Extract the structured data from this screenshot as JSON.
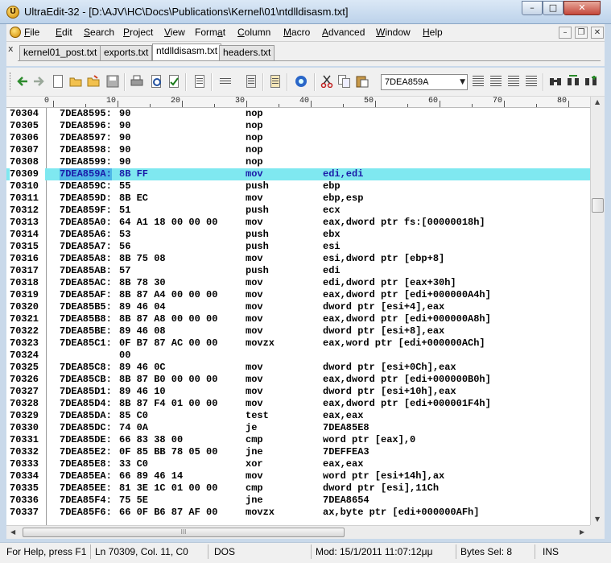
{
  "window": {
    "title": "UltraEdit-32 - [D:\\AJV\\HC\\Docs\\Publications\\Kernel\\01\\ntdlldisasm.txt]",
    "app_icon": "ultraedit-logo-icon",
    "controls": {
      "minimize": "–",
      "maximize": "□",
      "close": "✕"
    }
  },
  "menu": {
    "items": [
      {
        "key": "F",
        "rest": "ile"
      },
      {
        "key": "E",
        "rest": "dit"
      },
      {
        "key": "S",
        "rest": "earch"
      },
      {
        "key": "P",
        "rest": "roject"
      },
      {
        "key": "V",
        "rest": "iew"
      },
      {
        "pre": "Form",
        "key": "a",
        "rest": "t"
      },
      {
        "key": "C",
        "rest": "olumn"
      },
      {
        "key": "M",
        "rest": "acro"
      },
      {
        "key": "A",
        "rest": "dvanced"
      },
      {
        "key": "W",
        "rest": "indow"
      },
      {
        "key": "H",
        "rest": "elp"
      }
    ],
    "mdi_controls": {
      "minimize": "–",
      "restore": "❐",
      "close": "✕"
    }
  },
  "tabs": {
    "close_glyph": "x",
    "items": [
      {
        "label": "kernel01_post.txt",
        "active": false
      },
      {
        "label": "exports.txt",
        "active": false
      },
      {
        "label": "ntdlldisasm.txt",
        "active": true
      },
      {
        "label": "headers.txt",
        "active": false
      }
    ]
  },
  "toolbar": {
    "icons": [
      "back-arrow-icon",
      "forward-arrow-icon",
      "new-file-icon",
      "open-folder-icon",
      "open-recent-icon",
      "save-icon",
      "print-icon",
      "print-preview-icon",
      "spell-check-icon",
      "word-wrap-icon",
      "column-mode-icon",
      "hex-mode-icon",
      "ftp-icon",
      "browser-icon",
      "cut-icon",
      "copy-icon",
      "paste-icon",
      "find-icon",
      "replace-icon",
      "find-in-files-icon",
      "align-left-icon",
      "align-center-icon",
      "align-right-icon",
      "justify-icon"
    ],
    "find_value": "7DEA859A",
    "accent": "#1a6ec8"
  },
  "ruler": {
    "labels": [
      "0",
      "10",
      "20",
      "30",
      "40",
      "50",
      "60",
      "70",
      "80"
    ]
  },
  "editor": {
    "highlight_color": "#7fe8f0",
    "selection_color": "#4fb8e8",
    "rows": [
      {
        "ln": "70304",
        "addr": "7DEA8595:",
        "bytes": "90",
        "mn": "nop",
        "op": ""
      },
      {
        "ln": "70305",
        "addr": "7DEA8596:",
        "bytes": "90",
        "mn": "nop",
        "op": ""
      },
      {
        "ln": "70306",
        "addr": "7DEA8597:",
        "bytes": "90",
        "mn": "nop",
        "op": ""
      },
      {
        "ln": "70307",
        "addr": "7DEA8598:",
        "bytes": "90",
        "mn": "nop",
        "op": ""
      },
      {
        "ln": "70308",
        "addr": "7DEA8599:",
        "bytes": "90",
        "mn": "nop",
        "op": ""
      },
      {
        "ln": "70309",
        "addr": "7DEA859A:",
        "bytes": "8B FF",
        "mn": "mov",
        "op": "edi,edi",
        "hl": true
      },
      {
        "ln": "70310",
        "addr": "7DEA859C:",
        "bytes": "55",
        "mn": "push",
        "op": "ebp"
      },
      {
        "ln": "70311",
        "addr": "7DEA859D:",
        "bytes": "8B EC",
        "mn": "mov",
        "op": "ebp,esp"
      },
      {
        "ln": "70312",
        "addr": "7DEA859F:",
        "bytes": "51",
        "mn": "push",
        "op": "ecx"
      },
      {
        "ln": "70313",
        "addr": "7DEA85A0:",
        "bytes": "64 A1 18 00 00 00",
        "mn": "mov",
        "op": "eax,dword ptr fs:[00000018h]"
      },
      {
        "ln": "70314",
        "addr": "7DEA85A6:",
        "bytes": "53",
        "mn": "push",
        "op": "ebx"
      },
      {
        "ln": "70315",
        "addr": "7DEA85A7:",
        "bytes": "56",
        "mn": "push",
        "op": "esi"
      },
      {
        "ln": "70316",
        "addr": "7DEA85A8:",
        "bytes": "8B 75 08",
        "mn": "mov",
        "op": "esi,dword ptr [ebp+8]"
      },
      {
        "ln": "70317",
        "addr": "7DEA85AB:",
        "bytes": "57",
        "mn": "push",
        "op": "edi"
      },
      {
        "ln": "70318",
        "addr": "7DEA85AC:",
        "bytes": "8B 78 30",
        "mn": "mov",
        "op": "edi,dword ptr [eax+30h]"
      },
      {
        "ln": "70319",
        "addr": "7DEA85AF:",
        "bytes": "8B 87 A4 00 00 00",
        "mn": "mov",
        "op": "eax,dword ptr [edi+000000A4h]"
      },
      {
        "ln": "70320",
        "addr": "7DEA85B5:",
        "bytes": "89 46 04",
        "mn": "mov",
        "op": "dword ptr [esi+4],eax"
      },
      {
        "ln": "70321",
        "addr": "7DEA85B8:",
        "bytes": "8B 87 A8 00 00 00",
        "mn": "mov",
        "op": "eax,dword ptr [edi+000000A8h]"
      },
      {
        "ln": "70322",
        "addr": "7DEA85BE:",
        "bytes": "89 46 08",
        "mn": "mov",
        "op": "dword ptr [esi+8],eax"
      },
      {
        "ln": "70323",
        "addr": "7DEA85C1:",
        "bytes": "0F B7 87 AC 00 00",
        "mn": "movzx",
        "op": "eax,word ptr [edi+000000ACh]"
      },
      {
        "ln": "70324",
        "addr": "",
        "bytes": "00",
        "mn": "",
        "op": ""
      },
      {
        "ln": "70325",
        "addr": "7DEA85C8:",
        "bytes": "89 46 0C",
        "mn": "mov",
        "op": "dword ptr [esi+0Ch],eax"
      },
      {
        "ln": "70326",
        "addr": "7DEA85CB:",
        "bytes": "8B 87 B0 00 00 00",
        "mn": "mov",
        "op": "eax,dword ptr [edi+000000B0h]"
      },
      {
        "ln": "70327",
        "addr": "7DEA85D1:",
        "bytes": "89 46 10",
        "mn": "mov",
        "op": "dword ptr [esi+10h],eax"
      },
      {
        "ln": "70328",
        "addr": "7DEA85D4:",
        "bytes": "8B 87 F4 01 00 00",
        "mn": "mov",
        "op": "eax,dword ptr [edi+000001F4h]"
      },
      {
        "ln": "70329",
        "addr": "7DEA85DA:",
        "bytes": "85 C0",
        "mn": "test",
        "op": "eax,eax"
      },
      {
        "ln": "70330",
        "addr": "7DEA85DC:",
        "bytes": "74 0A",
        "mn": "je",
        "op": "7DEA85E8"
      },
      {
        "ln": "70331",
        "addr": "7DEA85DE:",
        "bytes": "66 83 38 00",
        "mn": "cmp",
        "op": "word ptr [eax],0"
      },
      {
        "ln": "70332",
        "addr": "7DEA85E2:",
        "bytes": "0F 85 BB 78 05 00",
        "mn": "jne",
        "op": "7DEFFEA3"
      },
      {
        "ln": "70333",
        "addr": "7DEA85E8:",
        "bytes": "33 C0",
        "mn": "xor",
        "op": "eax,eax"
      },
      {
        "ln": "70334",
        "addr": "7DEA85EA:",
        "bytes": "66 89 46 14",
        "mn": "mov",
        "op": "word ptr [esi+14h],ax"
      },
      {
        "ln": "70335",
        "addr": "7DEA85EE:",
        "bytes": "81 3E 1C 01 00 00",
        "mn": "cmp",
        "op": "dword ptr [esi],11Ch"
      },
      {
        "ln": "70336",
        "addr": "7DEA85F4:",
        "bytes": "75 5E",
        "mn": "jne",
        "op": "7DEA8654"
      },
      {
        "ln": "70337",
        "addr": "7DEA85F6:",
        "bytes": "66 0F B6 87 AF 00",
        "mn": "movzx",
        "op": "ax,byte ptr [edi+000000AFh]"
      }
    ]
  },
  "scroll": {
    "thumb_grip": "III"
  },
  "status": {
    "help": "For Help, press F1",
    "position": "Ln 70309, Col. 11, C0",
    "line_end": "DOS",
    "modified": "Mod: 15/1/2011 11:07:12μμ",
    "bytes_sel": "Bytes Sel: 8",
    "ins": "INS"
  }
}
